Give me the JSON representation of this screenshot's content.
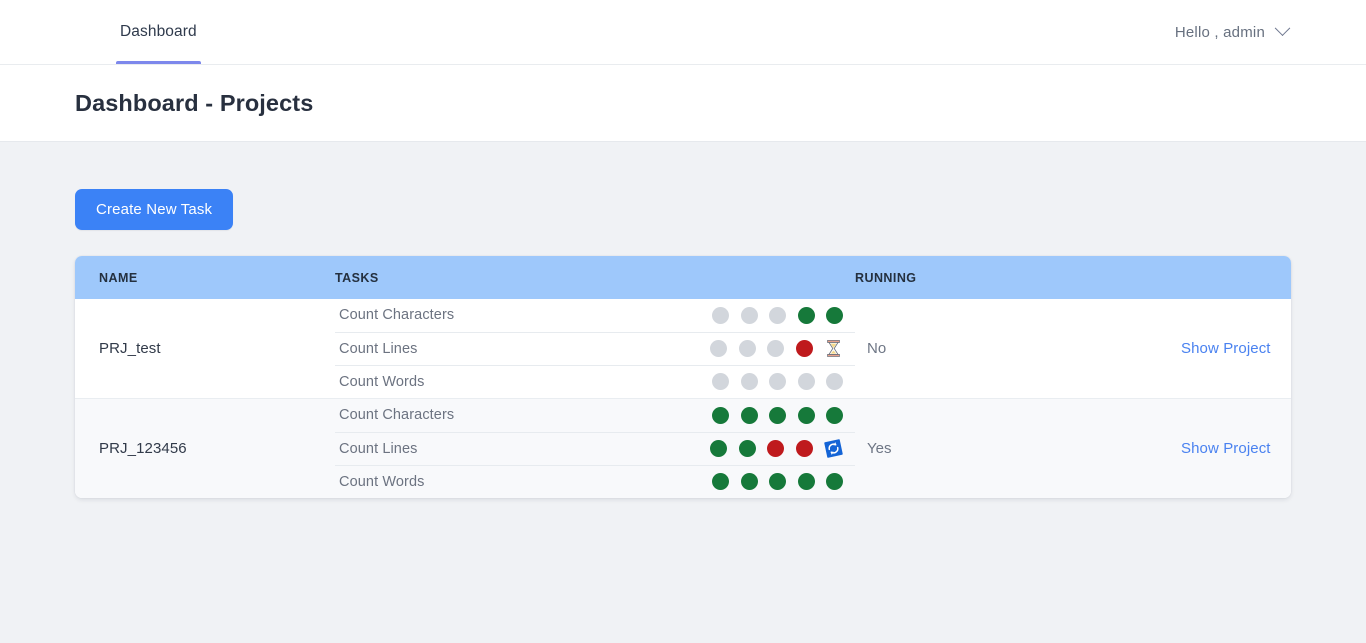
{
  "navbar": {
    "tabs": [
      {
        "label": "Dashboard",
        "active": true
      }
    ],
    "user_greeting": "Hello , admin",
    "user_chevron_icon": "chevron-down-icon"
  },
  "header": {
    "page_title": "Dashboard - Projects"
  },
  "toolbar": {
    "create_task_label": "Create New Task"
  },
  "table": {
    "columns": [
      "NAME",
      "TASKS",
      "RUNNING",
      ""
    ],
    "rows": [
      {
        "name": "PRJ_test",
        "running": "No",
        "action_label": "Show Project",
        "tasks": [
          {
            "label": "Count Characters",
            "statuses": [
              "grey",
              "grey",
              "grey",
              "green",
              "green"
            ]
          },
          {
            "label": "Count Lines",
            "statuses": [
              "grey",
              "grey",
              "grey",
              "red",
              "hourglass"
            ]
          },
          {
            "label": "Count Words",
            "statuses": [
              "grey",
              "grey",
              "grey",
              "grey",
              "grey"
            ]
          }
        ]
      },
      {
        "name": "PRJ_123456",
        "running": "Yes",
        "action_label": "Show Project",
        "tasks": [
          {
            "label": "Count Characters",
            "statuses": [
              "green",
              "green",
              "green",
              "green",
              "green"
            ]
          },
          {
            "label": "Count Lines",
            "statuses": [
              "green",
              "green",
              "red",
              "red",
              "refresh"
            ]
          },
          {
            "label": "Count Words",
            "statuses": [
              "green",
              "green",
              "green",
              "green",
              "green"
            ]
          }
        ]
      }
    ]
  },
  "colors": {
    "accent_blue": "#3b82f6",
    "link_blue": "#4a82f0",
    "tab_indicator": "#7d88ec",
    "table_header_bg": "#9ec8fb",
    "status_grey": "#d2d6dc",
    "status_green": "#16793a",
    "status_red": "#bf1a1d",
    "page_bg": "#f0f2f5"
  }
}
